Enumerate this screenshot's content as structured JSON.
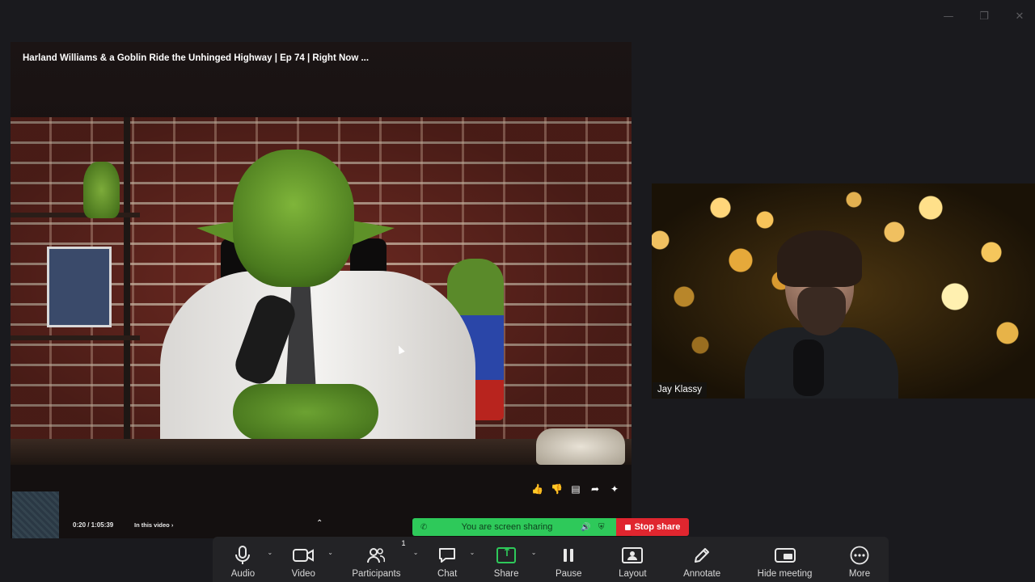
{
  "window": {
    "minimize": "—",
    "restore": "❐",
    "close": "✕"
  },
  "shared_screen": {
    "video_title": "Harland Williams & a Goblin Ride the Unhinged Highway | Ep 74 | Right Now ...",
    "time": "0:20 / 1:05:39",
    "in_this_video": "In this video",
    "chevron_right": "›",
    "collapse_chevron": "⌃",
    "actions": [
      "like-icon",
      "dislike-icon",
      "comment-icon",
      "share-icon",
      "sparkle-icon"
    ],
    "action_glyphs": [
      "👍",
      "👎",
      "▤",
      "➦",
      "✦"
    ]
  },
  "participant": {
    "name": "Jay Klassy"
  },
  "share_banner": {
    "text": "You are screen sharing",
    "stop_label": "Stop share",
    "icon_glyph": "✆",
    "volume_glyph": "🔊",
    "shield_glyph": "⛨"
  },
  "toolbar": {
    "caret": "⌄",
    "participants_count": "1",
    "items": [
      {
        "label": "Audio",
        "icon": "microphone-icon"
      },
      {
        "label": "Video",
        "icon": "camera-icon"
      },
      {
        "label": "Participants",
        "icon": "participants-icon"
      },
      {
        "label": "Chat",
        "icon": "chat-icon"
      },
      {
        "label": "Share",
        "icon": "share-screen-icon"
      },
      {
        "label": "Pause",
        "icon": "pause-icon"
      },
      {
        "label": "Layout",
        "icon": "layout-icon"
      },
      {
        "label": "Annotate",
        "icon": "pencil-icon"
      },
      {
        "label": "Hide meeting",
        "icon": "hide-meeting-icon"
      },
      {
        "label": "More",
        "icon": "more-icon"
      }
    ],
    "share_color": "#2ec95a",
    "stop_color": "#e0262f"
  }
}
